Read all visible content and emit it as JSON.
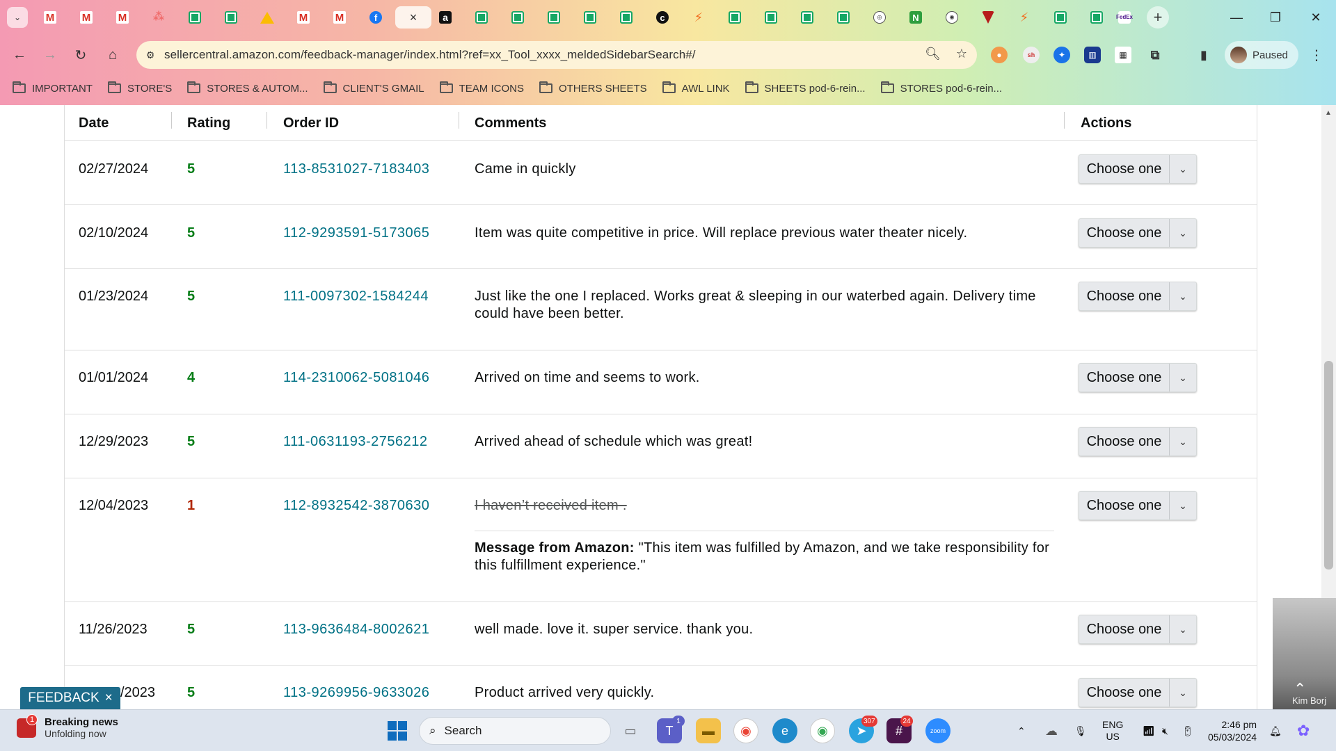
{
  "browser": {
    "url": "sellercentral.amazon.com/feedback-manager/index.html?ref=xx_Tool_xxxx_meldedSidebarSearch#/",
    "profile_label": "Paused",
    "bookmarks": [
      "IMPORTANT",
      "STORE'S",
      "STORES & AUTOM...",
      "CLIENT'S GMAIL",
      "TEAM ICONS",
      "OTHERS SHEETS",
      "AWL LINK",
      "SHEETS pod-6-rein...",
      "STORES pod-6-rein..."
    ]
  },
  "table": {
    "headers": {
      "date": "Date",
      "rating": "Rating",
      "order_id": "Order ID",
      "comments": "Comments",
      "actions": "Actions"
    },
    "action_label": "Choose one",
    "rows": [
      {
        "date": "02/27/2024",
        "rating": "5",
        "order_id": "113-8531027-7183403",
        "comment": "Came in quickly"
      },
      {
        "date": "02/10/2024",
        "rating": "5",
        "order_id": "112-9293591-5173065",
        "comment": "Item was quite competitive in price. Will replace previous water theater nicely."
      },
      {
        "date": "01/23/2024",
        "rating": "5",
        "order_id": "111-0097302-1584244",
        "comment": "Just like the one I replaced. Works great & sleeping in our waterbed again. Delivery time could have been better."
      },
      {
        "date": "01/01/2024",
        "rating": "4",
        "order_id": "114-2310062-5081046",
        "comment": "Arrived on time and seems to work."
      },
      {
        "date": "12/29/2023",
        "rating": "5",
        "order_id": "111-0631193-2756212",
        "comment": "Arrived ahead of schedule which was great!"
      },
      {
        "date": "12/04/2023",
        "rating": "1",
        "order_id": "112-8932542-3870630",
        "comment": "I haven’t received item .",
        "amazon_message_label": "Message from Amazon:",
        "amazon_message": "\"This item was fulfilled by Amazon, and we take responsibility for this fulfillment experience.\""
      },
      {
        "date": "11/26/2023",
        "rating": "5",
        "order_id": "113-9636484-8002621",
        "comment": "well made. love it. super service. thank you."
      },
      {
        "date": "/2023",
        "rating": "5",
        "order_id": "113-9269956-9633026",
        "comment": "Product arrived very quickly."
      }
    ]
  },
  "feedback_tab": {
    "label": "FEEDBACK",
    "close": "×"
  },
  "video_overlay": {
    "name": "Kim Borj"
  },
  "taskbar": {
    "news_title": "Breaking news",
    "news_subtitle": "Unfolding now",
    "news_badge": "1",
    "search_label": "Search",
    "teams_badge": "1",
    "telegram_badge": "307",
    "slack_badge": "24",
    "zoom_label": "zoom",
    "lang_top": "ENG",
    "lang_bottom": "US",
    "time": "2:46 pm",
    "date": "05/03/2024"
  },
  "colors": {
    "rating_good": "#067d17",
    "rating_bad": "#b12704",
    "order_link": "#007185"
  }
}
